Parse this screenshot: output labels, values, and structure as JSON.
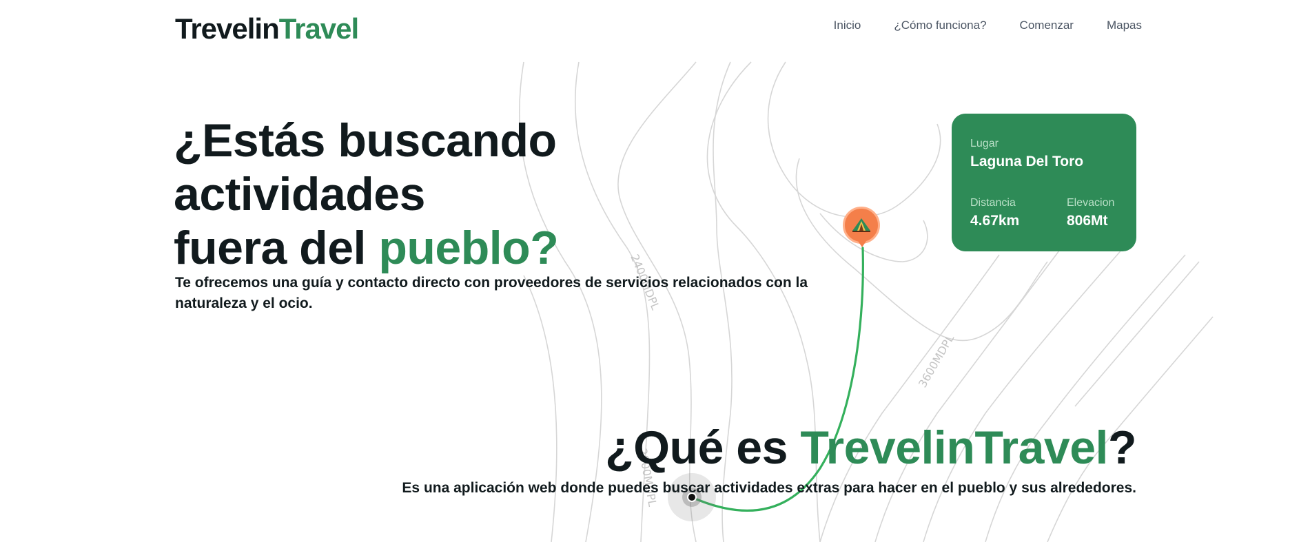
{
  "brand": {
    "part1": "Trevelin",
    "part2": "Travel"
  },
  "nav": {
    "items": [
      {
        "label": "Inicio"
      },
      {
        "label": "¿Cómo funciona?"
      },
      {
        "label": "Comenzar"
      },
      {
        "label": "Mapas"
      }
    ]
  },
  "hero": {
    "line1": "¿Estás buscando",
    "line2": "actividades",
    "line3_prefix": "fuera del ",
    "line3_highlight": "pueblo?",
    "subtitle": "Te ofrecemos una guía y contacto directo con proveedores de servicios relacionados con la naturaleza y el ocio."
  },
  "place_card": {
    "place_label": "Lugar",
    "place_value": "Laguna Del Toro",
    "distance_label": "Distancia",
    "distance_value": "4.67km",
    "elevation_label": "Elevacion",
    "elevation_value": "806Mt"
  },
  "map": {
    "contour_label_1": "2400MDPL",
    "contour_label_2": "3600MDPL",
    "contour_label_3": "2000MDPL",
    "destination_icon": "camp-tent-icon",
    "route_color": "#34b05c"
  },
  "about": {
    "title_prefix": "¿Qué es ",
    "title_highlight": "TrevelinTravel",
    "title_suffix": "?",
    "subtitle": "Es una aplicación web donde puedes buscar actividades extras para hacer en el pueblo y sus alrededores."
  },
  "colors": {
    "accent": "#2e8b57",
    "text": "#111a1d",
    "nav_text": "#4b5563",
    "pin": "#f47f4a"
  }
}
